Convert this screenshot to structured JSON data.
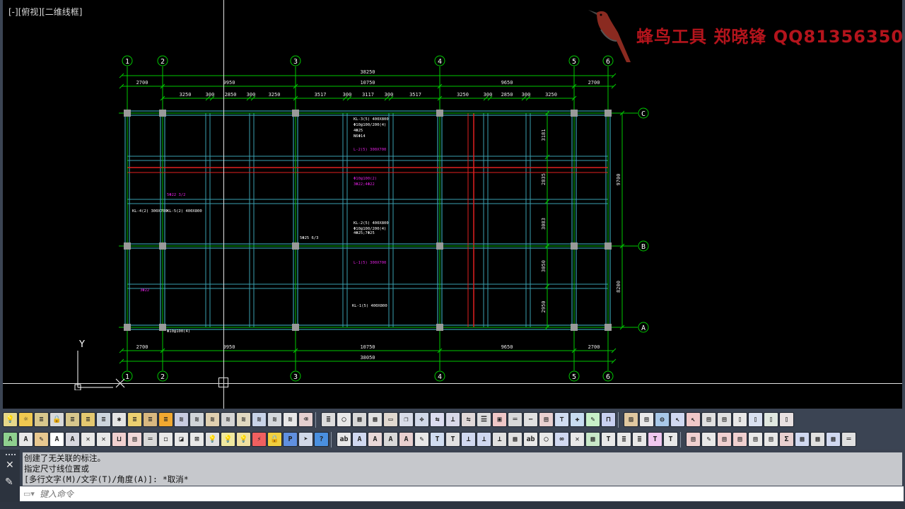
{
  "viewport": {
    "label": "[-][俯视][二维线框]",
    "watermark": "蜂鸟工具 郑晓锋 QQ81356350"
  },
  "drawing": {
    "grid_x_labels": [
      "1",
      "2",
      "3",
      "4",
      "5",
      "6"
    ],
    "grid_y_labels": [
      "C",
      "B",
      "A"
    ],
    "dims_top_total": "38250",
    "dims_top_axis": [
      "2700",
      "9950",
      "10750",
      "9650",
      "2700"
    ],
    "dims_top_detail": [
      "3250",
      "300",
      "2850",
      "300",
      "3250",
      "3517",
      "300",
      "3117",
      "300",
      "3517",
      "3250",
      "300",
      "2850",
      "300",
      "3250"
    ],
    "dims_bottom_axis": [
      "2700",
      "9950",
      "10750",
      "9650",
      "2700"
    ],
    "dims_bottom_total": "38050",
    "dims_right_axis": [
      "9700",
      "8200"
    ],
    "dims_right_detail": [
      "3181",
      "2835",
      "3083",
      "3050",
      "2950"
    ],
    "beam_labels": [
      "KL-3(5) 400X800",
      "Φ10@100/200(4)",
      "4Φ25",
      "N6Φ14",
      "L-2(5) 300X700",
      "Φ10@100(2)",
      "3Φ22;4Φ22",
      "KL-2(5) 400X800",
      "Φ10@100/200(4)",
      "4Φ25;7Φ25",
      "L-1(5) 300X700",
      "KL-1(5) 400X800",
      "KL-4(2) 300X700",
      "KL-5(2) 400X800",
      "5Φ22 3/2",
      "5Φ25 6/3",
      "Φ10@100(4)",
      "3Φ22"
    ],
    "ucs_y": "Y"
  },
  "toolbars": {
    "row1": [
      {
        "icon": "lamp-icon",
        "glyph": "💡",
        "bg": "#e6d78a"
      },
      {
        "icon": "sun-icon",
        "glyph": "☼",
        "bg": "#f0c850"
      },
      {
        "icon": "layer-icon",
        "glyph": "≡",
        "bg": "#d8c78c"
      },
      {
        "icon": "lock-icon",
        "glyph": "🔒",
        "bg": "#d9d9d9"
      },
      {
        "icon": "layer-icon",
        "glyph": "≡",
        "bg": "#d8c78c"
      },
      {
        "icon": "layer-icon",
        "glyph": "≡",
        "bg": "#e4c870"
      },
      {
        "icon": "layer-icon",
        "glyph": "≡",
        "bg": "#ccd4dc"
      },
      {
        "icon": "snow-icon",
        "glyph": "✱",
        "bg": "#e4e4e4"
      },
      {
        "icon": "layer-icon",
        "glyph": "≡",
        "bg": "#ecd070"
      },
      {
        "icon": "layer-icon",
        "glyph": "≡",
        "bg": "#d8b880"
      },
      {
        "icon": "layer-icon",
        "glyph": "≡",
        "bg": "#f0a830"
      },
      {
        "icon": "layers-icon",
        "glyph": "≋",
        "bg": "#c8cce0"
      },
      {
        "icon": "layers-icon",
        "glyph": "≋",
        "bg": "#d0d4d8"
      },
      {
        "icon": "layers-icon",
        "glyph": "≋",
        "bg": "#e0d0b0"
      },
      {
        "icon": "layers-icon",
        "glyph": "≋",
        "bg": "#d4d4d4"
      },
      {
        "icon": "layers-icon",
        "glyph": "≋",
        "bg": "#e0d8c0"
      },
      {
        "icon": "layers-icon",
        "glyph": "≋",
        "bg": "#c8d4e8"
      },
      {
        "icon": "layers-icon",
        "glyph": "≋",
        "bg": "#d4d8dc"
      },
      {
        "icon": "layers-icon",
        "glyph": "≋",
        "bg": "#e8e8e8"
      },
      {
        "icon": "eraser-icon",
        "glyph": "⌫",
        "bg": "#e4d0d0"
      },
      {
        "icon": "sep",
        "glyph": "",
        "bg": ""
      },
      {
        "icon": "list-icon",
        "glyph": "≣",
        "bg": "#dcdcdc"
      },
      {
        "icon": "circle-icon",
        "glyph": "◯",
        "bg": "#e8e8e8"
      },
      {
        "icon": "grid-icon",
        "glyph": "▦",
        "bg": "#d8d8d8"
      },
      {
        "icon": "grid-icon",
        "glyph": "▦",
        "bg": "#e0e0e0"
      },
      {
        "icon": "rect-icon",
        "glyph": "▭",
        "bg": "#e0d8d0"
      },
      {
        "icon": "copy-icon",
        "glyph": "❐",
        "bg": "#d8dce8"
      },
      {
        "icon": "move-icon",
        "glyph": "✥",
        "bg": "#d0d8e8"
      },
      {
        "icon": "arrow-icon",
        "glyph": "⇆",
        "bg": "#dcdcf0"
      },
      {
        "icon": "align-icon",
        "glyph": "⊥",
        "bg": "#d8d8e8"
      },
      {
        "icon": "flip-icon",
        "glyph": "⇋",
        "bg": "#e0d8d8"
      },
      {
        "icon": "lines-icon",
        "glyph": "☰",
        "bg": "#dcdcdc"
      },
      {
        "icon": "frame-icon",
        "glyph": "▣",
        "bg": "#f0c8c8"
      },
      {
        "icon": "hline-icon",
        "glyph": "═",
        "bg": "#d8d8d8"
      },
      {
        "icon": "minus-icon",
        "glyph": "−",
        "bg": "#e0e0e0"
      },
      {
        "icon": "table-icon",
        "glyph": "▤",
        "bg": "#e8d0d0"
      },
      {
        "icon": "axis-icon",
        "glyph": "⊤",
        "bg": "#d0dcf0"
      },
      {
        "icon": "node-icon",
        "glyph": "✚",
        "bg": "#c8dcf0"
      },
      {
        "icon": "pen-icon",
        "glyph": "✎",
        "bg": "#c8f0c8"
      },
      {
        "icon": "link-icon",
        "glyph": "⊓",
        "bg": "#c8d0f0"
      },
      {
        "icon": "sep",
        "glyph": "",
        "bg": ""
      },
      {
        "icon": "image-icon",
        "glyph": "▨",
        "bg": "#e0c8a0"
      },
      {
        "icon": "doc-icon",
        "glyph": "▤",
        "bg": "#e8e8e8"
      },
      {
        "icon": "globe-icon",
        "glyph": "◍",
        "bg": "#a8c8e8"
      },
      {
        "icon": "cursor-icon",
        "glyph": "↖",
        "bg": "#d0d8f0"
      },
      {
        "icon": "cursor-icon",
        "glyph": "↖",
        "bg": "#f0c8c8"
      },
      {
        "icon": "doc-icon",
        "glyph": "▤",
        "bg": "#e0e0e0"
      },
      {
        "icon": "doc-icon",
        "glyph": "▤",
        "bg": "#e0e0e0"
      },
      {
        "icon": "file-icon",
        "glyph": "▯",
        "bg": "#e8e8e8"
      },
      {
        "icon": "file-icon",
        "glyph": "▯",
        "bg": "#d8e0f0"
      },
      {
        "icon": "file-icon",
        "glyph": "▯",
        "bg": "#e0e8e0"
      },
      {
        "icon": "file-icon",
        "glyph": "▯",
        "bg": "#e8e0e0"
      }
    ],
    "row2": [
      {
        "icon": "text-icon",
        "glyph": "A",
        "bg": "#8fd08f"
      },
      {
        "icon": "text-icon",
        "glyph": "A",
        "bg": "#e8e8e8"
      },
      {
        "icon": "brush-icon",
        "glyph": "✎",
        "bg": "#e8c890"
      },
      {
        "icon": "text-icon",
        "glyph": "A",
        "bg": "#ffffff"
      },
      {
        "icon": "text-icon",
        "glyph": "A",
        "bg": "#d8d8e0"
      },
      {
        "icon": "cross-icon",
        "glyph": "✕",
        "bg": "#e8e8e8"
      },
      {
        "icon": "cross-icon",
        "glyph": "✕",
        "bg": "#e8e8e8"
      },
      {
        "icon": "box-icon",
        "glyph": "⊔",
        "bg": "#f0d0d0"
      },
      {
        "icon": "doc-icon",
        "glyph": "▤",
        "bg": "#f0d8d8"
      },
      {
        "icon": "hline-icon",
        "glyph": "═",
        "bg": "#d8d8d8"
      },
      {
        "icon": "rect-icon",
        "glyph": "◻",
        "bg": "#e8e8e8"
      },
      {
        "icon": "rect-icon",
        "glyph": "◪",
        "bg": "#e8e8e8"
      },
      {
        "icon": "cross-icon",
        "glyph": "⊠",
        "bg": "#e8e8e8"
      },
      {
        "icon": "bulb-icon",
        "glyph": "💡",
        "bg": "#e0e0e0"
      },
      {
        "icon": "bulb-icon",
        "glyph": "💡",
        "bg": "#f0e8a0"
      },
      {
        "icon": "bulb-icon",
        "glyph": "💡",
        "bg": "#f0e0a0"
      },
      {
        "icon": "bolt-icon",
        "glyph": "⚡",
        "bg": "#f06060"
      },
      {
        "icon": "lock-icon",
        "glyph": "🔒",
        "bg": "#f0d040"
      },
      {
        "icon": "pdf-icon",
        "glyph": "P",
        "bg": "#6090e0"
      },
      {
        "icon": "cursor-icon",
        "glyph": "➤",
        "bg": "#d0d8e8"
      },
      {
        "icon": "help-icon",
        "glyph": "?",
        "bg": "#4a90e0"
      },
      {
        "icon": "sep",
        "glyph": "",
        "bg": ""
      },
      {
        "icon": "abc-icon",
        "glyph": "ab",
        "bg": "#e8e8e8"
      },
      {
        "icon": "text-icon",
        "glyph": "A",
        "bg": "#d0d8f0"
      },
      {
        "icon": "text-icon",
        "glyph": "A",
        "bg": "#e8d8d8"
      },
      {
        "icon": "text-icon",
        "glyph": "A",
        "bg": "#d8d8d8"
      },
      {
        "icon": "text-icon",
        "glyph": "A",
        "bg": "#e8d0d0"
      },
      {
        "icon": "pen-icon",
        "glyph": "✎",
        "bg": "#e8e8e8"
      },
      {
        "icon": "text-icon",
        "glyph": "T",
        "bg": "#d0dcf0"
      },
      {
        "icon": "text-icon",
        "glyph": "T",
        "bg": "#e0e0e0"
      },
      {
        "icon": "vbar-icon",
        "glyph": "⊥",
        "bg": "#d0d8f0"
      },
      {
        "icon": "vbar-icon",
        "glyph": "⊥",
        "bg": "#d0d8f0"
      },
      {
        "icon": "vbar-icon",
        "glyph": "⊥",
        "bg": "#e0e0e0"
      },
      {
        "icon": "grid-icon",
        "glyph": "▦",
        "bg": "#e0e0e0"
      },
      {
        "icon": "abc-icon",
        "glyph": "ab",
        "bg": "#e8e8e8"
      },
      {
        "icon": "circle-icon",
        "glyph": "◯",
        "bg": "#e8e8e8"
      },
      {
        "icon": "link-icon",
        "glyph": "∞",
        "bg": "#d0d8f0"
      },
      {
        "icon": "cross-icon",
        "glyph": "✕",
        "bg": "#e8e8e8"
      },
      {
        "icon": "grid-icon",
        "glyph": "▦",
        "bg": "#c8e8c8"
      },
      {
        "icon": "text-icon",
        "glyph": "T",
        "bg": "#e8e8e8"
      },
      {
        "icon": "list-icon",
        "glyph": "≣",
        "bg": "#e8e8e8"
      },
      {
        "icon": "list-icon",
        "glyph": "≣",
        "bg": "#e8e8e8"
      },
      {
        "icon": "text-icon",
        "glyph": "T",
        "bg": "#f0c8f0"
      },
      {
        "icon": "text-icon",
        "glyph": "T",
        "bg": "#e8e8e8"
      },
      {
        "icon": "sep",
        "glyph": "",
        "bg": ""
      },
      {
        "icon": "doc-icon",
        "glyph": "▤",
        "bg": "#f0d0d0"
      },
      {
        "icon": "pen-icon",
        "glyph": "✎",
        "bg": "#e8e8e8"
      },
      {
        "icon": "doc-icon",
        "glyph": "▤",
        "bg": "#f0d0d0"
      },
      {
        "icon": "doc-icon",
        "glyph": "▤",
        "bg": "#f0d0d0"
      },
      {
        "icon": "doc-icon",
        "glyph": "▤",
        "bg": "#e8e8e8"
      },
      {
        "icon": "doc-icon",
        "glyph": "▤",
        "bg": "#e8e8e8"
      },
      {
        "icon": "sigma-icon",
        "glyph": "Σ",
        "bg": "#e8d0d0"
      },
      {
        "icon": "grid-icon",
        "glyph": "▦",
        "bg": "#d0d8f0"
      },
      {
        "icon": "grid-icon",
        "glyph": "▦",
        "bg": "#e0e0e0"
      },
      {
        "icon": "grid-icon",
        "glyph": "▦",
        "bg": "#d0d8f0"
      },
      {
        "icon": "hline-icon",
        "glyph": "═",
        "bg": "#e0e0e0"
      }
    ]
  },
  "command": {
    "history": [
      "创建了无关联的标注。",
      "指定尺寸线位置或",
      "[多行文字(M)/文字(T)/角度(A)]: *取消*"
    ],
    "placeholder": "键入命令"
  },
  "colors": {
    "grid_axis": "#00c800",
    "beam": "#40c0d0",
    "rebar_text": "#e020e0",
    "highlight": "#e02020",
    "column": "#9a9a9a"
  }
}
